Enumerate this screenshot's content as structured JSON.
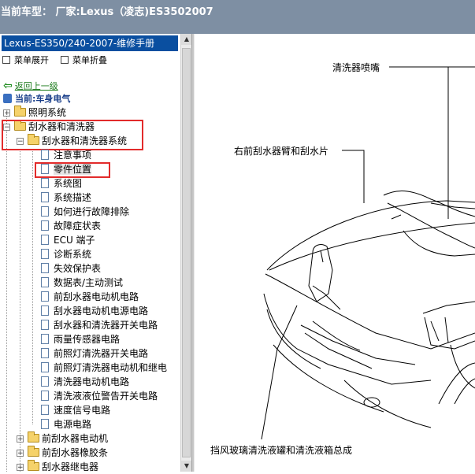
{
  "window": {
    "title": "当前车型：  厂家:Lexus（凌志)ES3502007"
  },
  "sidebar": {
    "header": "Lexus-ES350/240-2007-维修手册",
    "expand_label": "菜单展开",
    "collapse_label": "菜单折叠",
    "back_label": "返回上一级",
    "current_label": "当前:车身电气",
    "tree": {
      "lighting": "照明系统",
      "wiper_washer": "刮水器和清洗器",
      "wiper_washer_system": "刮水器和清洗器系统",
      "leaves": [
        "注意事项",
        "零件位置",
        "系统图",
        "系统描述",
        "如何进行故障排除",
        "故障症状表",
        "ECU 端子",
        "诊断系统",
        "失效保护表",
        "数据表/主动测试",
        "前刮水器电动机电路",
        "刮水器电动机电源电路",
        "刮水器和清洗器开关电路",
        "雨量传感器电路",
        "前照灯清洗器开关电路",
        "前照灯清洗器电动机和继电",
        "清洗器电动机电路",
        "清洗液液位警告开关电路",
        "速度信号电路",
        "电源电路"
      ],
      "bottom_folders": [
        "前刮水器电动机",
        "前刮水器橡胶条",
        "刮水器继电器"
      ]
    },
    "selected_item": "零件位置"
  },
  "figure": {
    "labels": {
      "washer_nozzle": "清洗器喷嘴",
      "right_front_wiper": "右前刮水器臂和刮水片",
      "washer_tank": "挡风玻璃清洗液罐和清洗液箱总成"
    }
  }
}
